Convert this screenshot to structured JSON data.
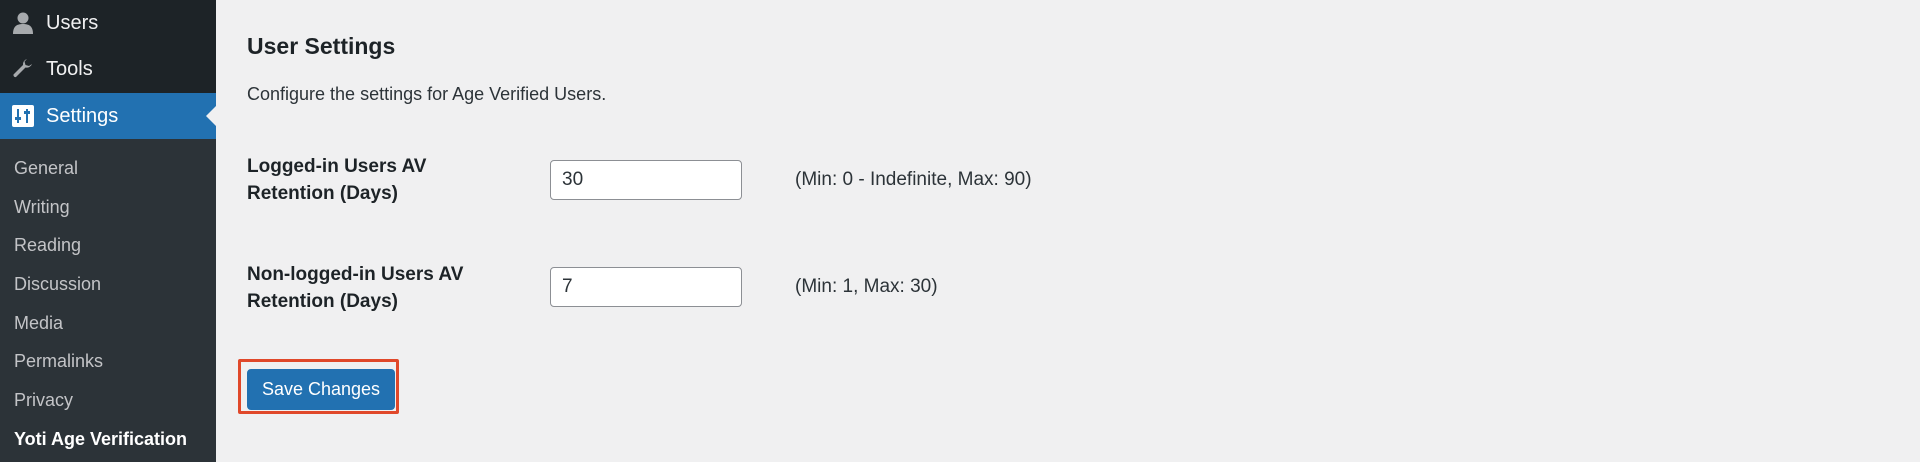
{
  "sidebar": {
    "menu": [
      {
        "label": "Users",
        "icon": "user-icon"
      },
      {
        "label": "Tools",
        "icon": "wrench-icon"
      },
      {
        "label": "Settings",
        "icon": "settings-sliders-icon",
        "active": true
      }
    ],
    "submenu": [
      {
        "label": "General"
      },
      {
        "label": "Writing"
      },
      {
        "label": "Reading"
      },
      {
        "label": "Discussion"
      },
      {
        "label": "Media"
      },
      {
        "label": "Permalinks"
      },
      {
        "label": "Privacy"
      },
      {
        "label": "Yoti Age Verification",
        "current": true
      }
    ]
  },
  "main": {
    "title": "User Settings",
    "description": "Configure the settings for Age Verified Users.",
    "fields": [
      {
        "label": "Logged-in Users AV Retention (Days)",
        "value": "30",
        "hint": "(Min: 0 - Indefinite, Max: 90)"
      },
      {
        "label": "Non-logged-in Users AV Retention (Days)",
        "value": "7",
        "hint": "(Min: 1, Max: 30)"
      }
    ],
    "save_label": "Save Changes"
  },
  "colors": {
    "sidebar_bg": "#2c3338",
    "sidebar_top_bg": "#1d2327",
    "accent": "#2271b1",
    "highlight": "#e0482a",
    "page_bg": "#f0f0f1"
  }
}
